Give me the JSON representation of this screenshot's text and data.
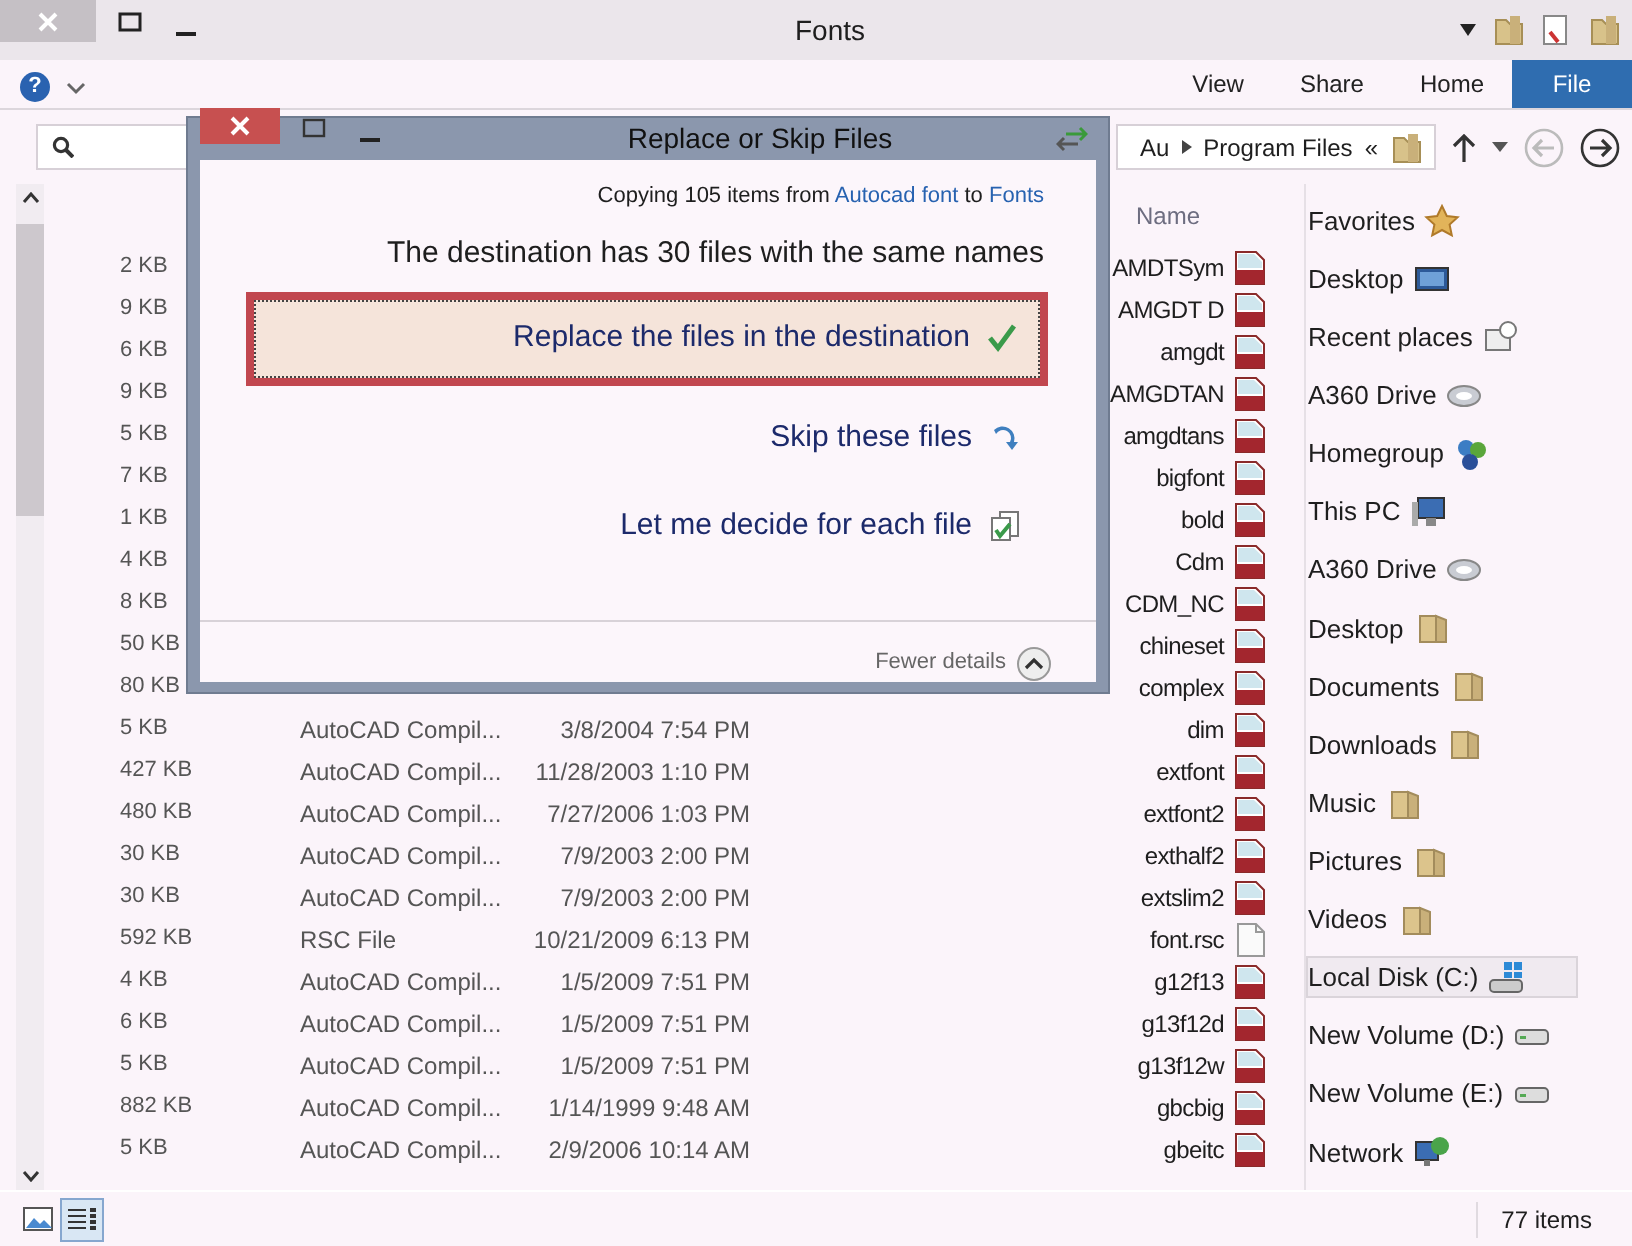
{
  "window": {
    "title": "Fonts"
  },
  "ribbon": {
    "help": "?",
    "tabs": [
      {
        "label": "View",
        "kind": "tab"
      },
      {
        "label": "Share",
        "kind": "tab"
      },
      {
        "label": "Home",
        "kind": "tab"
      },
      {
        "label": "File",
        "kind": "file"
      }
    ]
  },
  "address": {
    "overflow": "«",
    "path": [
      "Au",
      "Program Files"
    ],
    "back_disabled": true
  },
  "file_list": {
    "header": "Name",
    "rows": [
      {
        "name": "AMDTSym",
        "size": "2 KB",
        "kind": "shx"
      },
      {
        "name": "AMGDT D",
        "size": "9 KB",
        "kind": "shx"
      },
      {
        "name": "amgdt",
        "size": "6 KB",
        "kind": "shx"
      },
      {
        "name": "AMGDTAN",
        "size": "9 KB",
        "kind": "shx"
      },
      {
        "name": "amgdtans",
        "size": "5 KB",
        "kind": "shx"
      },
      {
        "name": "bigfont",
        "size": "7 KB",
        "kind": "shx"
      },
      {
        "name": "bold",
        "size": "1 KB",
        "kind": "shx"
      },
      {
        "name": "Cdm",
        "size": "4 KB",
        "kind": "shx"
      },
      {
        "name": "CDM_NC",
        "size": "8 KB",
        "kind": "shx"
      },
      {
        "name": "chineset",
        "size": "50 KB",
        "kind": "shx"
      },
      {
        "name": "complex",
        "size": "80 KB",
        "kind": "shx"
      },
      {
        "name": "dim",
        "date": "3/8/2004 7:54 PM",
        "type": "AutoCAD Compil...",
        "size": "5 KB",
        "kind": "shx"
      },
      {
        "name": "extfont",
        "date": "11/28/2003 1:10 PM",
        "type": "AutoCAD Compil...",
        "size": "427 KB",
        "kind": "shx"
      },
      {
        "name": "extfont2",
        "date": "7/27/2006 1:03 PM",
        "type": "AutoCAD Compil...",
        "size": "480 KB",
        "kind": "shx"
      },
      {
        "name": "exthalf2",
        "date": "7/9/2003 2:00 PM",
        "type": "AutoCAD Compil...",
        "size": "30 KB",
        "kind": "shx"
      },
      {
        "name": "extslim2",
        "date": "7/9/2003 2:00 PM",
        "type": "AutoCAD Compil...",
        "size": "30 KB",
        "kind": "shx"
      },
      {
        "name": "font.rsc",
        "date": "10/21/2009 6:13 PM",
        "type": "RSC File",
        "size": "592 KB",
        "kind": "file"
      },
      {
        "name": "g12f13",
        "date": "1/5/2009 7:51 PM",
        "type": "AutoCAD Compil...",
        "size": "4 KB",
        "kind": "shx"
      },
      {
        "name": "g13f12d",
        "date": "1/5/2009 7:51 PM",
        "type": "AutoCAD Compil...",
        "size": "6 KB",
        "kind": "shx"
      },
      {
        "name": "g13f12w",
        "date": "1/5/2009 7:51 PM",
        "type": "AutoCAD Compil...",
        "size": "5 KB",
        "kind": "shx"
      },
      {
        "name": "gbcbig",
        "date": "1/14/1999 9:48 AM",
        "type": "AutoCAD Compil...",
        "size": "882 KB",
        "kind": "shx"
      },
      {
        "name": "gbeitc",
        "date": "2/9/2006 10:14 AM",
        "type": "AutoCAD Compil...",
        "size": "5 KB",
        "kind": "shx"
      }
    ]
  },
  "navigation": [
    {
      "label": "Favorites",
      "kind": "star",
      "selected": false,
      "children": [
        {
          "label": "Desktop",
          "kind": "monitor",
          "selected": false
        },
        {
          "label": "Recent places",
          "kind": "recent",
          "selected": false
        },
        {
          "label": "A360 Drive",
          "kind": "cloud",
          "selected": false
        }
      ]
    },
    {
      "label": "Homegroup",
      "kind": "homegroup",
      "selected": false
    },
    {
      "label": "This PC",
      "kind": "pc",
      "selected": false,
      "children": [
        {
          "label": "A360 Drive",
          "kind": "cloud",
          "selected": false
        },
        {
          "label": "Desktop",
          "kind": "folder",
          "selected": false
        },
        {
          "label": "Documents",
          "kind": "folder",
          "selected": false
        },
        {
          "label": "Downloads",
          "kind": "folder",
          "selected": false
        },
        {
          "label": "Music",
          "kind": "folder",
          "selected": false
        },
        {
          "label": "Pictures",
          "kind": "folder",
          "selected": false
        },
        {
          "label": "Videos",
          "kind": "folder",
          "selected": false
        },
        {
          "label": "Local Disk (C:)",
          "kind": "disk",
          "selected": true
        },
        {
          "label": "New Volume (D:)",
          "kind": "drive",
          "selected": false
        },
        {
          "label": "New Volume (E:)",
          "kind": "drive",
          "selected": false
        }
      ]
    },
    {
      "label": "Network",
      "kind": "network",
      "selected": false
    }
  ],
  "dialog": {
    "title": "Replace or Skip Files",
    "summary": {
      "prefix": "Copying 105 items from",
      "source": "Autocad font",
      "middle": "to",
      "destination": "Fonts"
    },
    "message": "The destination has 30 files with the same names",
    "options": [
      {
        "label": "Replace the files in the destination",
        "kind": "replace",
        "selected": true
      },
      {
        "label": "Skip these files",
        "kind": "skip",
        "selected": false
      },
      {
        "label": "Let me decide for each file",
        "kind": "decide",
        "selected": false
      }
    ],
    "details_toggle": "Fewer details"
  },
  "status_bar": {
    "item_count": "77 items",
    "views": [
      {
        "kind": "thumbnails",
        "selected": false
      },
      {
        "kind": "details",
        "selected": true
      }
    ]
  }
}
